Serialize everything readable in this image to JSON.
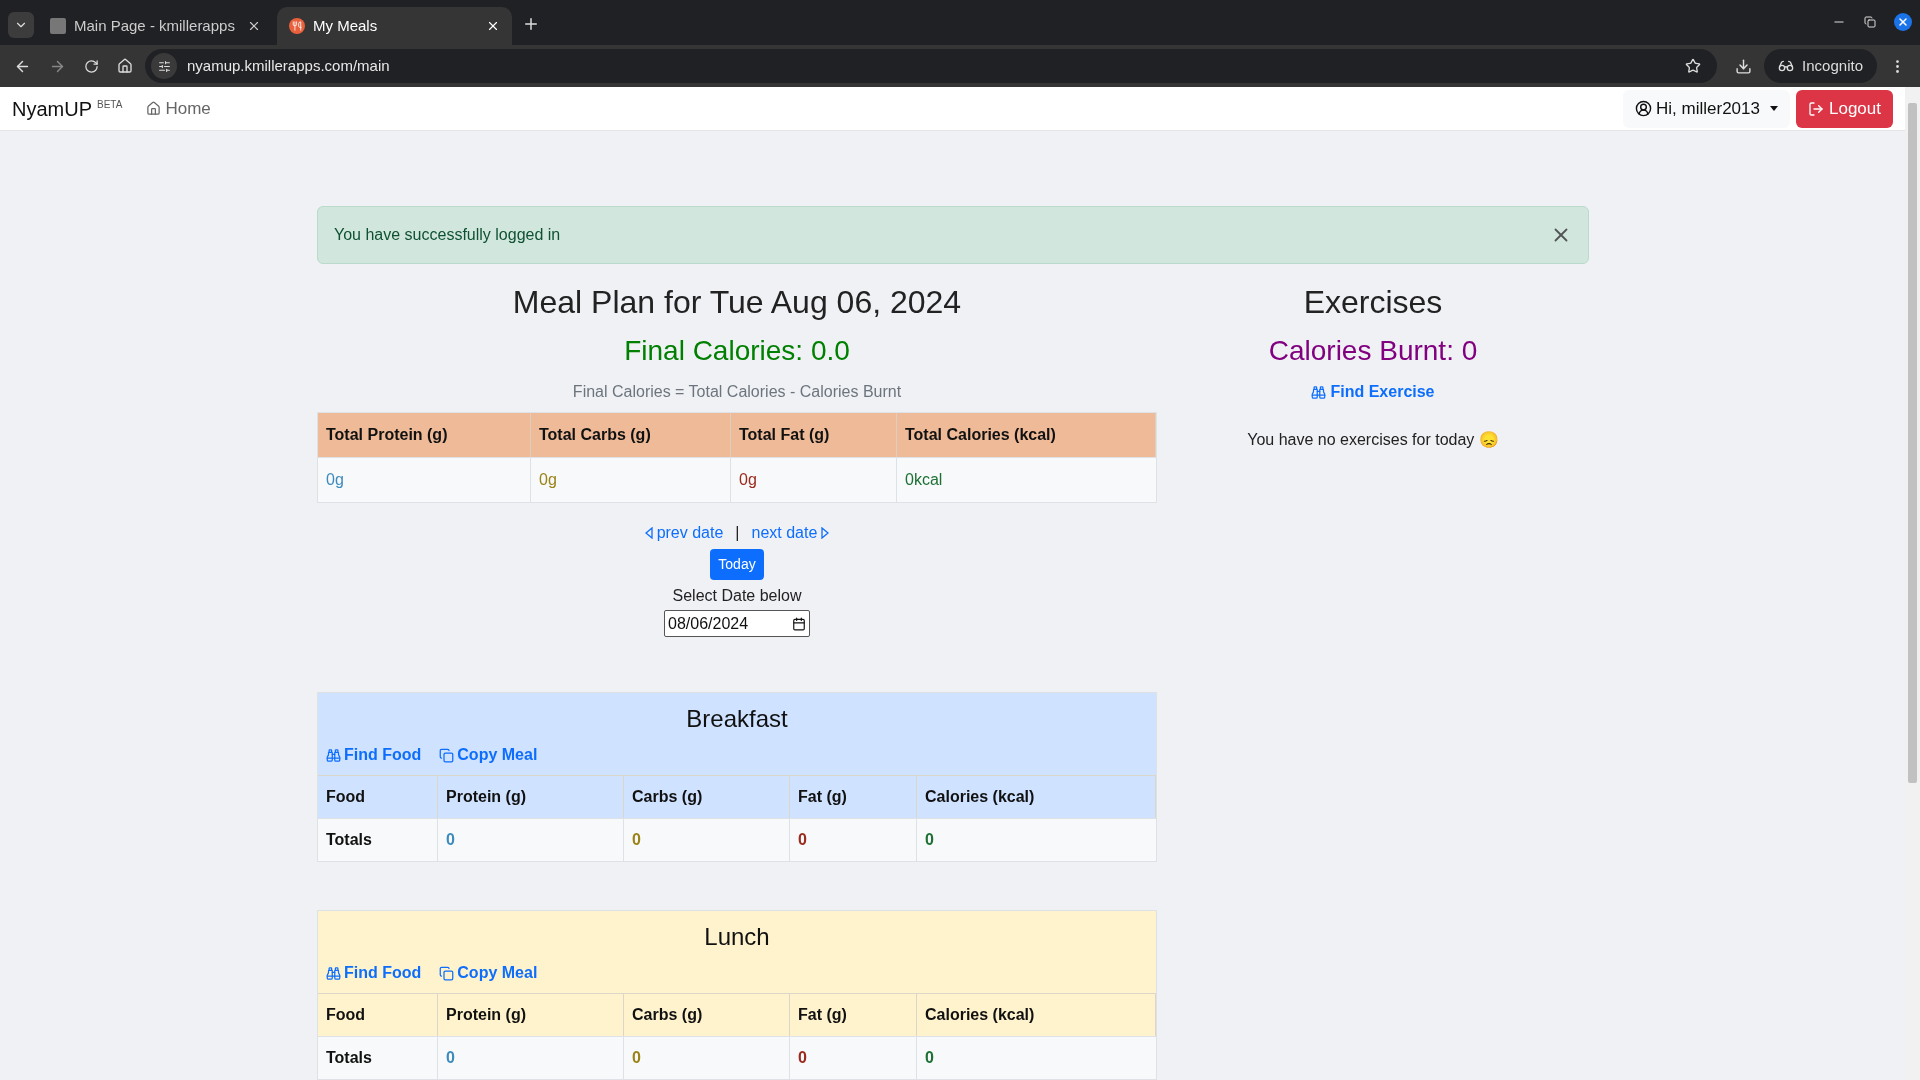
{
  "browser": {
    "tabs": [
      {
        "title": "Main Page - kmillerapps",
        "selected": false
      },
      {
        "title": "My Meals",
        "selected": true
      }
    ],
    "url": "nyamup.kmillerapps.com/main",
    "profile": "Incognito"
  },
  "navbar": {
    "brand": "NyamUP",
    "badge": "BETA",
    "home": "Home",
    "user": "Hi, miller2013",
    "logout": "Logout"
  },
  "alert": "You have successfully logged in",
  "meal_plan": {
    "title": "Meal Plan for Tue Aug 06, 2024",
    "final_calories": "Final Calories: 0.0",
    "formula": "Final Calories = Total Calories - Calories Burnt",
    "totals_columns": [
      "Total Protein (g)",
      "Total Carbs (g)",
      "Total Fat (g)",
      "Total Calories (kcal)"
    ],
    "totals_values": [
      "0g",
      "0g",
      "0g",
      "0kcal"
    ],
    "prev_date": "prev date",
    "separator": "|",
    "next_date": "next date",
    "today": "Today",
    "select_label": "Select Date below",
    "date_value": "08/06/2024"
  },
  "meals": [
    {
      "name": "Breakfast",
      "color": "#cfe2ff",
      "find": "Find Food",
      "copy": "Copy Meal",
      "columns": [
        "Food",
        "Protein (g)",
        "Carbs (g)",
        "Fat (g)",
        "Calories (kcal)"
      ],
      "totals": [
        "Totals",
        "0",
        "0",
        "0",
        "0"
      ]
    },
    {
      "name": "Lunch",
      "color": "#fff3cd",
      "find": "Find Food",
      "copy": "Copy Meal",
      "columns": [
        "Food",
        "Protein (g)",
        "Carbs (g)",
        "Fat (g)",
        "Calories (kcal)"
      ],
      "totals": [
        "Totals",
        "0",
        "0",
        "0",
        "0"
      ]
    }
  ],
  "exercises": {
    "title": "Exercises",
    "burnt": "Calories Burnt: 0",
    "find": "Find Exercise",
    "empty": "You have no exercises for today 😞"
  }
}
